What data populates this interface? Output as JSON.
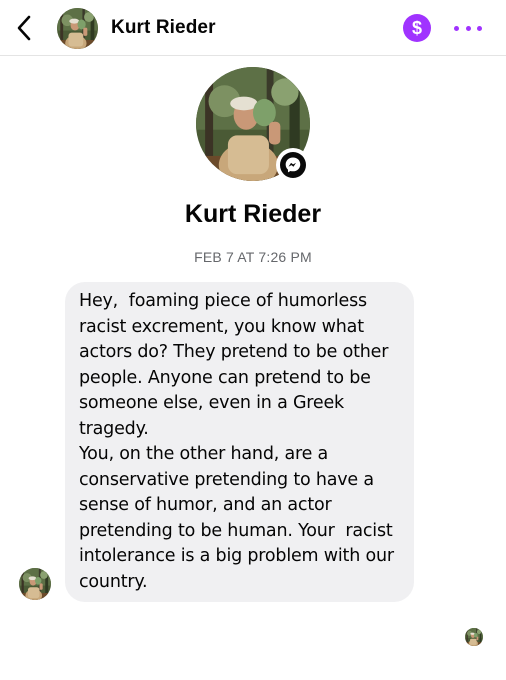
{
  "header": {
    "back_icon": "chevron-left-icon",
    "contact_name": "Kurt Rieder",
    "pay_icon": "dollar-icon",
    "pay_symbol": "$",
    "more_icon": "more-horizontal-icon"
  },
  "profile": {
    "name": "Kurt Rieder",
    "badge_icon": "messenger-icon"
  },
  "conversation": {
    "timestamp": "FEB 7 AT 7:26 PM",
    "messages": [
      {
        "text": "Hey,  foaming piece of humorless\nracist excrement, you know what\nactors do? They pretend to be other\npeople. Anyone can pretend to be\nsomeone else, even in a Greek\ntragedy.\nYou, on the other hand, are a\nconservative pretending to have a\nsense of humor, and an actor\npretending to be human. Your  racist\nintolerance is a big problem with our\ncountry."
      }
    ]
  },
  "colors": {
    "accent": "#a033ff",
    "bubble": "#f0f0f2",
    "timestamp": "#65676b"
  }
}
